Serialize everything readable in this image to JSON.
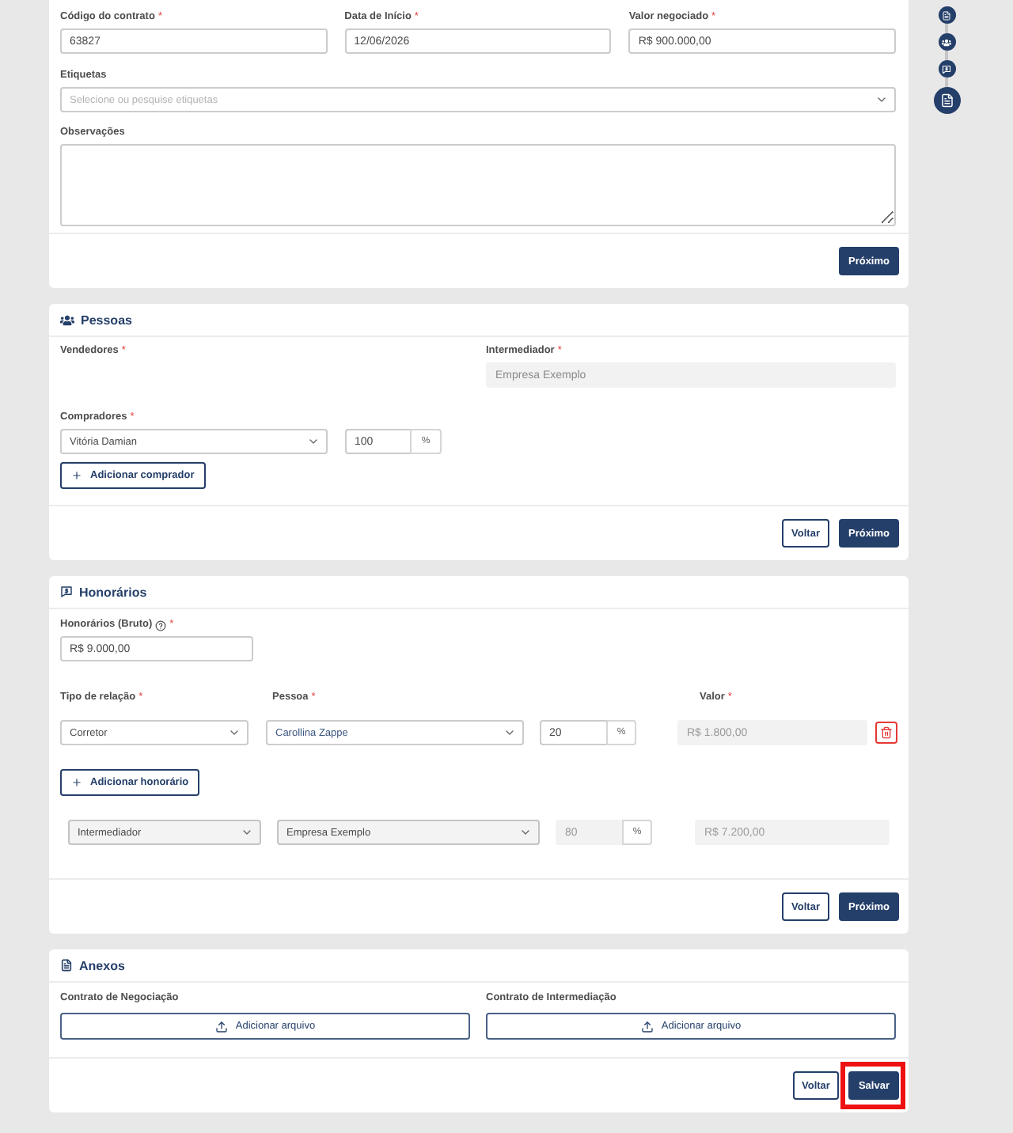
{
  "stepper": [
    {
      "kind": "contract",
      "selected": false
    },
    {
      "kind": "people",
      "selected": false
    },
    {
      "kind": "fees",
      "selected": false
    },
    {
      "kind": "attachments",
      "selected": true
    }
  ],
  "contract": {
    "fields": [
      {
        "label": "Código do contrato",
        "required_mark": "*",
        "value": "63827"
      },
      {
        "label": "Data de Início",
        "required_mark": "*",
        "value": "12/06/2026"
      },
      {
        "label": "Valor negociado",
        "required_mark": "*",
        "value": "R$ 900.000,00"
      }
    ],
    "tags": {
      "label": "Etiquetas",
      "placeholder": "Selecione ou pesquise etiquetas"
    },
    "notes": {
      "label": "Observações"
    },
    "buttons": [
      {
        "label": "Próximo",
        "kind": "next"
      }
    ]
  },
  "people": {
    "title": "Pessoas",
    "sellers": {
      "label": "Vendedores",
      "required_mark": "*"
    },
    "intermediary": {
      "label": "Intermediador",
      "required_mark": "*",
      "value": "Empresa Exemplo",
      "disabled": true
    },
    "buyers": {
      "label": "Compradores",
      "required_mark": "*",
      "rows": [
        {
          "name": "Vitória Damian",
          "percent": "100",
          "unit": "%"
        }
      ],
      "add_button": "Adicionar comprador"
    },
    "buttons": [
      {
        "label": "Voltar",
        "kind": "back"
      },
      {
        "label": "Próximo",
        "kind": "next"
      }
    ]
  },
  "fees": {
    "title": "Honorários",
    "gross": {
      "label": "Honorários (Bruto)",
      "required_mark": "*",
      "value": "R$ 9.000,00"
    },
    "columns": [
      {
        "label": "Tipo de relação",
        "required_mark": "*"
      },
      {
        "label": "Pessoa",
        "required_mark": "*"
      },
      {
        "label": "Valor",
        "required_mark": "*"
      }
    ],
    "rows": [
      {
        "type": "Corretor",
        "person": "Carollina Zappe",
        "percent": "20",
        "unit": "%",
        "value": "R$ 1.800,00",
        "disabled": false,
        "removable": true
      }
    ],
    "add_button": "Adicionar honorário",
    "intermediary_row": {
      "type": "Intermediador",
      "person": "Empresa Exemplo",
      "percent": "80",
      "unit": "%",
      "value": "R$ 7.200,00",
      "disabled": true,
      "removable": false
    },
    "buttons": [
      {
        "label": "Voltar",
        "kind": "back"
      },
      {
        "label": "Próximo",
        "kind": "next"
      }
    ]
  },
  "attachments": {
    "title": "Anexos",
    "items": [
      {
        "label": "Contrato de Negociação",
        "button": "Adicionar arquivo"
      },
      {
        "label": "Contrato de Intermediação",
        "button": "Adicionar arquivo"
      }
    ],
    "buttons": [
      {
        "label": "Voltar",
        "kind": "back",
        "highlighted": false
      },
      {
        "label": "Salvar",
        "kind": "save",
        "highlighted": true
      }
    ]
  }
}
